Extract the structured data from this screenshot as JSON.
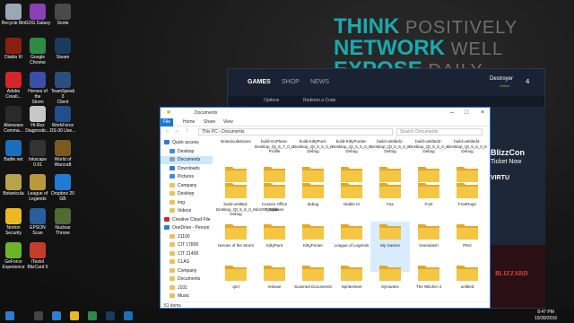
{
  "wallpaper": {
    "line1_a": "THINK",
    "line1_b": "POSITIVELY",
    "line2_a": "NETWORK",
    "line2_b": "WELL",
    "line3_a": "EXPOSE",
    "line3_b": "DAILY"
  },
  "desktop_icons": [
    {
      "label": "Recycle Bin",
      "icon": "recycle-bin-icon",
      "color": "#9aa7b4"
    },
    {
      "label": "GOG Galaxy",
      "icon": "gog-galaxy-icon",
      "color": "#8a3fb3"
    },
    {
      "label": "Snote",
      "icon": "snote-icon",
      "color": "#4a4a4a"
    },
    {
      "label": "Diablo III",
      "icon": "diablo-iii-icon",
      "color": "#8a1f12"
    },
    {
      "label": "Google\nChrome",
      "icon": "chrome-icon",
      "color": "#2e8b45"
    },
    {
      "label": "Steam",
      "icon": "steam-icon",
      "color": "#1b3a5c"
    },
    {
      "label": "Adobe\nCreati...",
      "icon": "adobe-cc-icon",
      "color": "#d4242c"
    },
    {
      "label": "Heroes of the\nStorm",
      "icon": "heroes-of-the-storm-icon",
      "color": "#3a4fa8"
    },
    {
      "label": "TeamSpeak 3\nClient",
      "icon": "teamspeak-icon",
      "color": "#2b4f7c"
    },
    {
      "label": "Alienware\nComma...",
      "icon": "alienware-icon",
      "color": "#2a2a2a"
    },
    {
      "label": "Hi-Rez\nDiagnostic...",
      "icon": "hi-rez-icon",
      "color": "#c7c7c7"
    },
    {
      "label": "WorkForce\nDS-30 Use...",
      "icon": "workforce-icon",
      "color": "#1f4f8f"
    },
    {
      "label": "Battle.net",
      "icon": "battlenet-icon",
      "color": "#1b6fb8"
    },
    {
      "label": "Inkscape 0.91",
      "icon": "inkscape-icon",
      "color": "#333333"
    },
    {
      "label": "World of\nWarcraft",
      "icon": "world-of-warcraft-icon",
      "color": "#7a5a1e"
    },
    {
      "label": "Botanicula",
      "icon": "botanicula-icon",
      "color": "#b8a34a"
    },
    {
      "label": "League of\nLegends",
      "icon": "league-of-legends-icon",
      "color": "#b89a3a"
    },
    {
      "label": "Dropbox 20\nGB",
      "icon": "dropbox-icon",
      "color": "#1f7bd6"
    },
    {
      "label": "Norton\nSecurity",
      "icon": "norton-icon",
      "color": "#e8b923"
    },
    {
      "label": "EPSON Scan",
      "icon": "epson-scan-icon",
      "color": "#2a5d9c"
    },
    {
      "label": "Nuclear\nThrone",
      "icon": "nuclear-throne-icon",
      "color": "#4f6b2f"
    },
    {
      "label": "GeForce\nExperience",
      "icon": "geforce-icon",
      "color": "#6bb52a"
    },
    {
      "label": "iTestol\nBlizCard 5",
      "icon": "itestol-icon",
      "color": "#c43d2b"
    }
  ],
  "battlenet": {
    "tabs": [
      "GAMES",
      "SHOP",
      "NEWS"
    ],
    "user": "Destroyer",
    "status": "Online",
    "friends_count": "4",
    "options_label": "Options",
    "redeem_label": "Redeem a Code",
    "banner_title": "BlizzCon",
    "banner_sub": "Ticket Now",
    "banner_top": "VIRTU",
    "promo_text": "BLIZZARD"
  },
  "explorer": {
    "title": "Documents",
    "ribbon_tabs": [
      "File",
      "Home",
      "Share",
      "View"
    ],
    "address": "This PC  ›  Documents",
    "search_placeholder": "Search Documents",
    "nav": [
      {
        "label": "Quick access",
        "icon": "star-icon",
        "color": "#2a7fd4",
        "selected": false
      },
      {
        "label": "Desktop",
        "icon": "desktop-icon",
        "color": "#3d8fd9",
        "selected": false
      },
      {
        "label": "Documents",
        "icon": "documents-icon",
        "color": "#9aa0a8",
        "selected": true
      },
      {
        "label": "Downloads",
        "icon": "downloads-icon",
        "color": "#2a7fd4",
        "selected": false
      },
      {
        "label": "Pictures",
        "icon": "pictures-icon",
        "color": "#3d8fd9",
        "selected": false
      },
      {
        "label": "Company",
        "icon": "folder-icon",
        "color": "#e8c25a",
        "selected": false
      },
      {
        "label": "Desktop",
        "icon": "folder-icon",
        "color": "#e8c25a",
        "selected": false
      },
      {
        "label": "img",
        "icon": "folder-icon",
        "color": "#e8c25a",
        "selected": false
      },
      {
        "label": "Videos",
        "icon": "folder-icon",
        "color": "#e8c25a",
        "selected": false
      },
      {
        "label": "Creative Cloud File",
        "icon": "creative-cloud-icon",
        "color": "#d4242c",
        "selected": false
      },
      {
        "label": "OneDrive - Person",
        "icon": "onedrive-icon",
        "color": "#2a7fd4",
        "selected": false
      },
      {
        "label": "21100",
        "icon": "folder-icon",
        "color": "#e8c25a",
        "selected": false
      },
      {
        "label": "CIT 17800",
        "icon": "folder-icon",
        "color": "#e8c25a",
        "selected": false
      },
      {
        "label": "CIT 21400",
        "icon": "folder-icon",
        "color": "#e8c25a",
        "selected": false
      },
      {
        "label": "CLAS",
        "icon": "folder-icon",
        "color": "#e8c25a",
        "selected": false
      },
      {
        "label": "Company",
        "icon": "folder-icon",
        "color": "#e8c25a",
        "selected": false
      },
      {
        "label": "Documents",
        "icon": "folder-icon",
        "color": "#e8c25a",
        "selected": false
      },
      {
        "label": "J101",
        "icon": "folder-icon",
        "color": "#e8c25a",
        "selected": false
      },
      {
        "label": "Music",
        "icon": "folder-icon",
        "color": "#e8c25a",
        "selected": false
      }
    ],
    "items": [
      {
        "name": "BotaniculaSaves",
        "kind": "folder"
      },
      {
        "name": "build-GoPlane-Desktop_Qt_5_7_0_MinGW_32bit-Profile",
        "kind": "folder"
      },
      {
        "name": "build-KittyPunt-Desktop_Qt_5_5_0_MinGW_32bit-Debug",
        "kind": "folder"
      },
      {
        "name": "build-KittyPunter-Desktop_Qt_5_5_0_MinGW_32bit-Debug",
        "kind": "folder"
      },
      {
        "name": "build-untitled1-Desktop_Qt_5_6_0_MinGW_32bit-Debug",
        "kind": "folder"
      },
      {
        "name": "build-untitled2-Desktop_Qt_5_6_0_MinGW_32bit-Debug",
        "kind": "folder"
      },
      {
        "name": "build-untitled3-Desktop_Qt_5_6_0_MinGW_32bit-Debug",
        "kind": "folder"
      },
      {
        "name": "build-untitled-Desktop_Qt_5_5_0_MinGW_32bit-Debug",
        "kind": "folder"
      },
      {
        "name": "Custom Office Templates",
        "kind": "folder"
      },
      {
        "name": "debug",
        "kind": "folder"
      },
      {
        "name": "Diablo III",
        "kind": "folder"
      },
      {
        "name": "Fax",
        "kind": "folder"
      },
      {
        "name": "Font",
        "kind": "folder"
      },
      {
        "name": "FreeRogn",
        "kind": "folder"
      },
      {
        "name": "Heroes of the Storm",
        "kind": "folder"
      },
      {
        "name": "KittyPunt",
        "kind": "folder"
      },
      {
        "name": "KittyPunter",
        "kind": "folder"
      },
      {
        "name": "League of Legends",
        "kind": "folder"
      },
      {
        "name": "My Games",
        "kind": "folder"
      },
      {
        "name": "Overwatch",
        "kind": "folder"
      },
      {
        "name": "PNG",
        "kind": "folder"
      },
      {
        "name": "qml",
        "kind": "folder"
      },
      {
        "name": "release",
        "kind": "folder"
      },
      {
        "name": "Scanned Documents",
        "kind": "folder"
      },
      {
        "name": "Spritesheet",
        "kind": "folder"
      },
      {
        "name": "Symantec",
        "kind": "folder"
      },
      {
        "name": "The Witcher 3",
        "kind": "folder"
      },
      {
        "name": "untitled",
        "kind": "folder"
      }
    ],
    "status": "51 items"
  },
  "taskbar": {
    "time": "8:47 PM",
    "date": "10/30/2016"
  },
  "colors": {
    "accent": "#1979ca",
    "wallpaper_teal": "#1aa9b0",
    "folder_yellow": "#f5c644",
    "folder_dark": "#e0a92b"
  }
}
